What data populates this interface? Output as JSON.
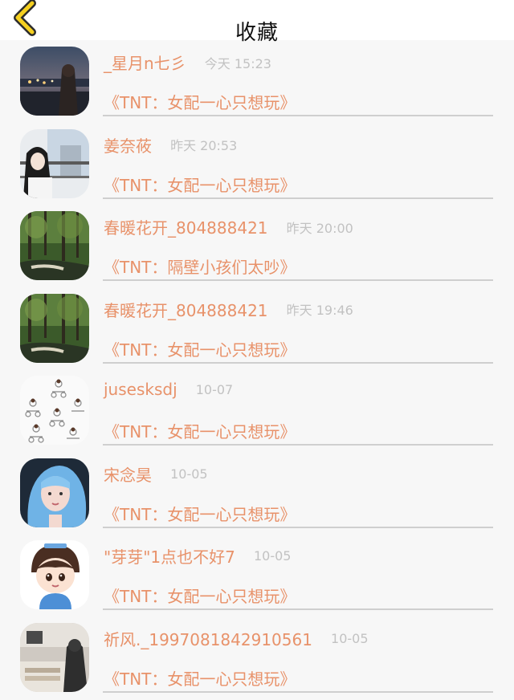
{
  "header": {
    "title": "收藏",
    "back_icon": "chevron-left-icon",
    "accent_color": "#f5d020"
  },
  "favorites": [
    {
      "user": "_星月n七彡",
      "time": "今天 15:23",
      "work": "《TNT：女配一心只想玩》",
      "avatar": "night-city-girl"
    },
    {
      "user": "姜奈莜",
      "time": "昨天 20:53",
      "work": "《TNT：女配一心只想玩》",
      "avatar": "girl-at-window"
    },
    {
      "user": "春暖花开_804888421",
      "time": "昨天 20:00",
      "work": "《TNT：隔壁小孩们太吵》",
      "avatar": "forest-waterfall"
    },
    {
      "user": "春暖花开_804888421",
      "time": "昨天 19:46",
      "work": "《TNT：女配一心只想玩》",
      "avatar": "forest-waterfall"
    },
    {
      "user": "jusesksdj",
      "time": "10-07",
      "work": "《TNT：女配一心只想玩》",
      "avatar": "cartoon-doodles"
    },
    {
      "user": "宋念昊",
      "time": "10-05",
      "work": "《TNT：女配一心只想玩》",
      "avatar": "blue-hair-girl"
    },
    {
      "user": "\"芽芽\"1点也不好7",
      "time": "10-05",
      "work": "《TNT：女配一心只想玩》",
      "avatar": "chibi-boy"
    },
    {
      "user": "祈风._1997081842910561",
      "time": "10-05",
      "work": "《TNT：女配一心只想玩》",
      "avatar": "room-photo"
    }
  ],
  "colors": {
    "name_and_title": "#e8926a",
    "timestamp": "#c2c2c2",
    "divider": "#cfcfcf"
  }
}
